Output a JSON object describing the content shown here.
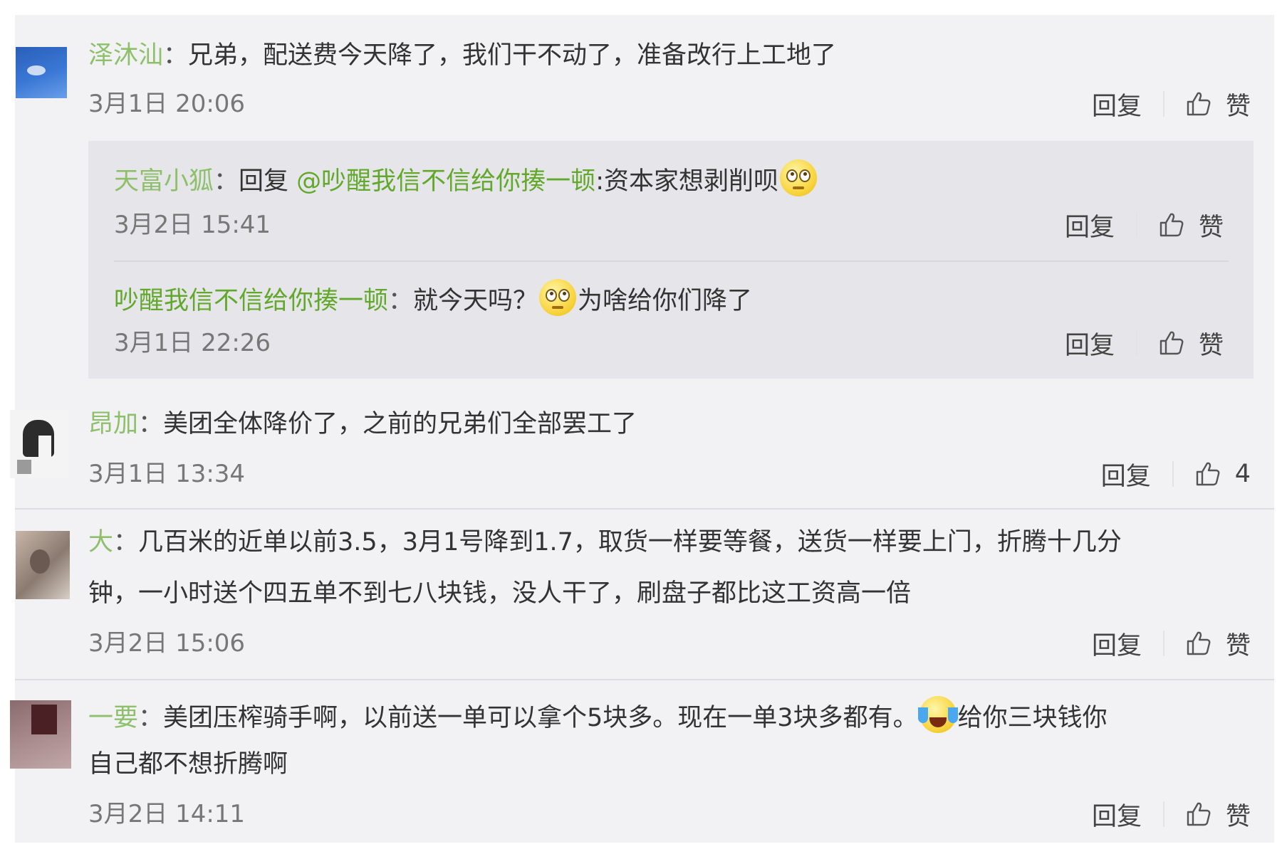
{
  "comments": [
    {
      "username": "泽沐汕",
      "separator": "：",
      "text": "兄弟，配送费今天降了，我们干不动了，准备改行上工地了",
      "time": "3月1日 20:06",
      "reply_label": "回复",
      "like_label": "赞",
      "sub_replies": [
        {
          "username": "天富小狐",
          "separator": "：",
          "reply_prefix": "回复 ",
          "mention": "@吵醒我信不信给你揍一顿",
          "text": ":资本家想剥削呗",
          "emoji": "dizzy-face-emoji",
          "time": "3月2日 15:41",
          "reply_label": "回复",
          "like_label": "赞"
        },
        {
          "username": "吵醒我信不信给你揍一顿",
          "separator": "：",
          "text_before": "就今天吗？",
          "emoji": "dizzy-face-emoji",
          "text_after": "为啥给你们降了",
          "time": "3月1日 22:26",
          "reply_label": "回复",
          "like_label": "赞"
        }
      ]
    },
    {
      "username": "昂加",
      "separator": "：",
      "text": "美团全体降价了，之前的兄弟们全部罢工了",
      "time": "3月1日 13:34",
      "reply_label": "回复",
      "like_label": "4"
    },
    {
      "username": "大",
      "separator": "：",
      "text_line1": "几百米的近单以前3.5，3月1号降到1.7，取货一样要等餐，送货一样要上门，折腾十几分",
      "text_line2": "钟，一小时送个四五单不到七八块钱，没人干了，刷盘子都比这工资高一倍",
      "time": "3月2日 15:06",
      "reply_label": "回复",
      "like_label": "赞"
    },
    {
      "username": "一要",
      "separator": "：",
      "text_before": "美团压榨骑手啊，以前送一单可以拿个5块多。现在一单3块多都有。",
      "emoji": "laughing-tears-emoji",
      "text_after": "给你三块钱你",
      "text_line2": "自己都不想折腾啊",
      "time": "3月2日 14:11",
      "reply_label": "回复",
      "like_label": "赞"
    }
  ],
  "colors": {
    "panel_bg": "#f2f2f5",
    "subreply_bg": "#e6e6ea",
    "username_green": "#8ec06c",
    "mention_green": "#62a92b",
    "text": "#333333",
    "meta": "#777777"
  }
}
